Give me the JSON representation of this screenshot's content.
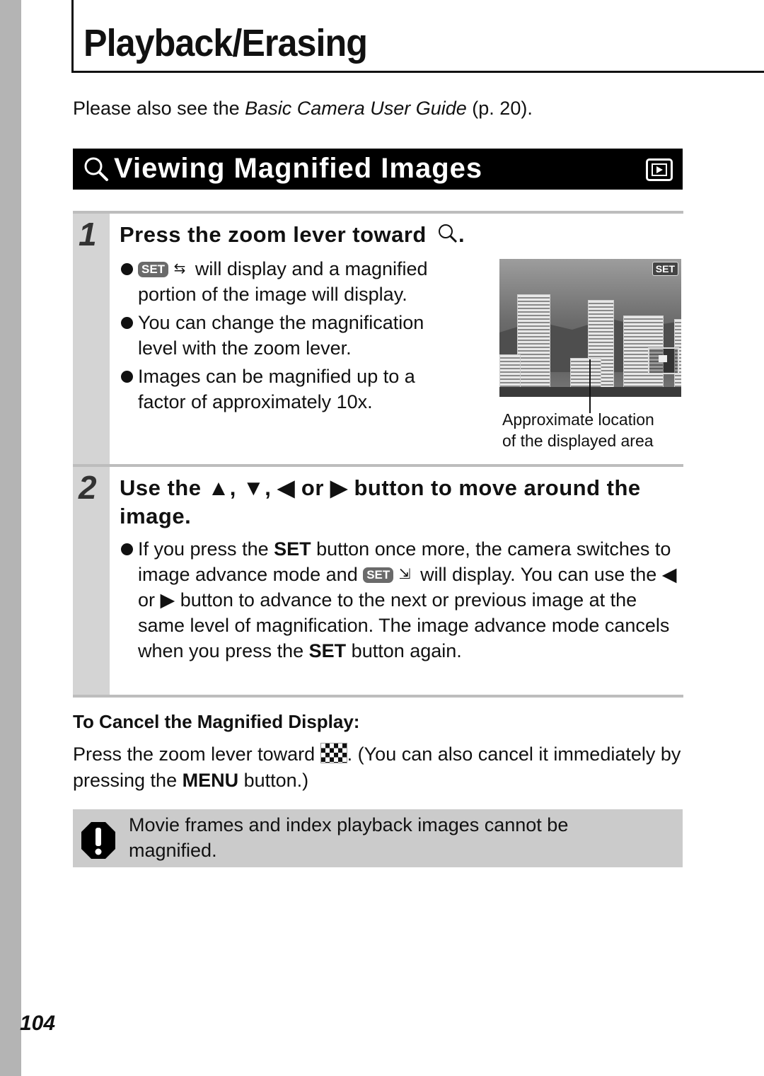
{
  "page": {
    "title": "Playback/Erasing",
    "page_number": "104",
    "intro": {
      "prefix": "Please also see the ",
      "guide_title": "Basic Camera User Guide",
      "suffix": " (p. 20)."
    }
  },
  "section": {
    "icon": "magnify-icon",
    "title": "Viewing Magnified Images",
    "mode_icon": "playback-mode-icon"
  },
  "steps": [
    {
      "number": "1",
      "heading": "Press the zoom lever toward",
      "heading_icon": "magnify-icon",
      "bullets": [
        {
          "badge": "SET",
          "icon": "magnify-scroll-icon",
          "text": " will display and a magnified portion of the image will display."
        },
        {
          "text": "You can change the magnification level with the zoom lever."
        },
        {
          "text": "Images can be magnified up to a factor of approximately 10x."
        }
      ],
      "figure": {
        "badge": "SET",
        "caption_line1": "Approximate location",
        "caption_line2": "of the displayed area"
      }
    },
    {
      "number": "2",
      "heading_parts": [
        "Use the ",
        "▲",
        ", ",
        "▼",
        ", ",
        "◀",
        " or ",
        "▶",
        " button to move around the image."
      ],
      "bullet": {
        "p1": "If you press the ",
        "set1": "SET",
        "p2": " button once more, the camera switches to image advance mode and ",
        "badge": "SET",
        "p3": " will display. You can use the ",
        "left": "◀",
        "p4": " or ",
        "right": "▶",
        "p5": " button to advance to the next or previous image at the same level of magnification. The image advance mode cancels when you press the ",
        "set2": "SET",
        "p6": " button again."
      }
    }
  ],
  "cancel": {
    "heading": "To Cancel the Magnified Display:",
    "p1": "Press the zoom lever toward ",
    "icon": "index-playback-icon",
    "p2": ". (You can also cancel it immediately by pressing the ",
    "menu": "MENU",
    "p3": " button.)"
  },
  "note": {
    "icon": "caution-icon",
    "text": "Movie frames and index playback images cannot be magnified."
  }
}
